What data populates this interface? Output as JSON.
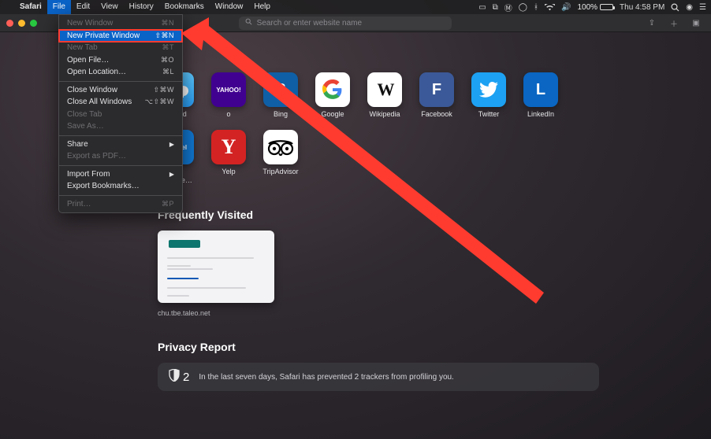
{
  "menubar": {
    "app": "Safari",
    "items": [
      "File",
      "Edit",
      "View",
      "History",
      "Bookmarks",
      "Window",
      "Help"
    ],
    "active": "File",
    "status": {
      "battery_pct": "100%",
      "clock": "Thu 4:58 PM"
    }
  },
  "safari": {
    "address_placeholder": "Search or enter website name"
  },
  "file_menu": [
    {
      "label": "New Window",
      "shortcut": "⌘N",
      "sep": false,
      "disabled": true
    },
    {
      "label": "New Private Window",
      "shortcut": "⇧⌘N",
      "sep": false,
      "highlight": true,
      "boxed": true
    },
    {
      "label": "New Tab",
      "shortcut": "⌘T",
      "sep": false,
      "disabled": true
    },
    {
      "label": "Open File…",
      "shortcut": "⌘O",
      "sep": false
    },
    {
      "label": "Open Location…",
      "shortcut": "⌘L",
      "sep": true
    },
    {
      "label": "Close Window",
      "shortcut": "⇧⌘W",
      "sep": false
    },
    {
      "label": "Close All Windows",
      "shortcut": "⌥⇧⌘W",
      "sep": false
    },
    {
      "label": "Close Tab",
      "shortcut": "",
      "sep": false,
      "disabled": true
    },
    {
      "label": "Save As…",
      "shortcut": "",
      "sep": true,
      "disabled": true
    },
    {
      "label": "Share",
      "shortcut": "",
      "sep": false,
      "submenu": true
    },
    {
      "label": "Export as PDF…",
      "shortcut": "",
      "sep": true,
      "disabled": true
    },
    {
      "label": "Import From",
      "shortcut": "",
      "sep": false,
      "submenu": true
    },
    {
      "label": "Export Bookmarks…",
      "shortcut": "",
      "sep": true
    },
    {
      "label": "Print…",
      "shortcut": "⌘P",
      "sep": false,
      "disabled": true
    }
  ],
  "favorites_row1": [
    {
      "label": "iCloud",
      "cls": "icloud",
      "glyph": "☁"
    },
    {
      "label": "o",
      "cls": "yahoo",
      "glyph": "YAHOO!"
    },
    {
      "label": "Bing",
      "cls": "bing",
      "glyph": "B"
    },
    {
      "label": "Google",
      "cls": "google",
      "glyph": "G"
    },
    {
      "label": "Wikipedia",
      "cls": "wiki",
      "glyph": "W"
    },
    {
      "label": "Facebook",
      "cls": "fb",
      "glyph": "F"
    },
    {
      "label": "Twitter",
      "cls": "tw",
      "glyph": ""
    },
    {
      "label": "LinkedIn",
      "cls": "li",
      "glyph": "L"
    }
  ],
  "favorites_row2": [
    {
      "label": "The Weathe…",
      "cls": "weather",
      "glyph": "her\nnel"
    },
    {
      "label": "Yelp",
      "cls": "yelp",
      "glyph": "Y"
    },
    {
      "label": "TripAdvisor",
      "cls": "trip",
      "glyph": ""
    }
  ],
  "sections": {
    "freq_title": "Frequently Visited",
    "freq_caption": "chu.tbe.taleo.net",
    "privacy_title": "Privacy Report",
    "privacy_count": "2",
    "privacy_text": "In the last seven days, Safari has prevented 2 trackers from profiling you."
  }
}
